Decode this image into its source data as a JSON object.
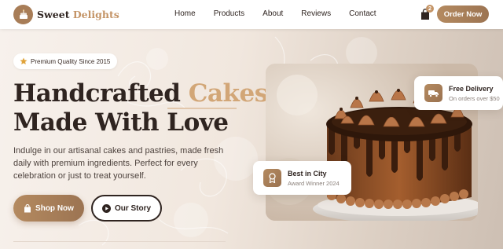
{
  "brand": {
    "name_part1": "Sweet",
    "name_part2": "Delights"
  },
  "nav": {
    "items": [
      "Home",
      "Products",
      "About",
      "Reviews",
      "Contact"
    ]
  },
  "cart": {
    "count": "2"
  },
  "header": {
    "order_label": "Order Now"
  },
  "hero": {
    "badge": "Premium Quality Since 2015",
    "headline_line1_part1": "Handcrafted ",
    "headline_line1_accent": "Cakes",
    "headline_line2": "Made With Love",
    "description": "Indulge in our artisanal cakes and pastries, made fresh daily with premium ingredients. Perfect for every celebration or just to treat yourself.",
    "shop_label": "Shop Now",
    "story_label": "Our Story"
  },
  "cards": {
    "delivery": {
      "title": "Free Delivery",
      "subtitle": "On orders over $50"
    },
    "city": {
      "title": "Best in City",
      "subtitle": "Award Winner 2024"
    }
  },
  "colors": {
    "accent": "#c49466",
    "button_brown": "#a87d57",
    "text_dark": "#2f2420",
    "star": "#e0a33a"
  },
  "icons": {
    "logo": "cake-icon",
    "badge": "star-icon",
    "cart": "shopping-bag-icon",
    "shop": "bag-icon",
    "story": "play-circle-icon",
    "delivery": "truck-icon",
    "city": "award-icon"
  }
}
